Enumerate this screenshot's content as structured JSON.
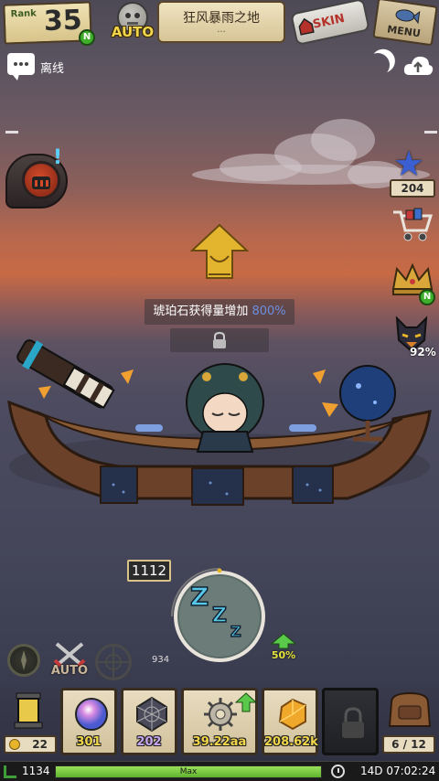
{
  "top": {
    "rank_label": "Rank",
    "rank_value": "35",
    "rank_badge": "N",
    "auto_label": "AUTO",
    "location_title": "狂风暴雨之地",
    "location_sub": "...",
    "skin_label": "SKIN",
    "menu_label": "MENU"
  },
  "status": {
    "offline_label": "离线"
  },
  "right": {
    "star_count": "204",
    "crown_badge": "N",
    "fox_percent": "92%"
  },
  "buff": {
    "text": "琥珀石获得量增加",
    "value": "800%"
  },
  "timer": {
    "value": "1112",
    "sub_value": "934",
    "boost": "50%",
    "boost_fraction": 0.5
  },
  "controls": {
    "auto_label": "AUTO"
  },
  "bottom": {
    "gold": "22",
    "slots": [
      {
        "value": "301",
        "color": "#f2d64a"
      },
      {
        "value": "202",
        "color": "#c9a6f0"
      },
      {
        "value": "39.22aa",
        "color": "#f2d64a"
      },
      {
        "value": "208.62k",
        "color": "#f2d64a"
      }
    ],
    "bag": "6 / 12"
  },
  "footer": {
    "level": "1134",
    "xp_label": "Max",
    "xp_fraction": 1.0,
    "time": "14D 07:02:24"
  },
  "colors": {
    "accent_green": "#3fae2a",
    "highlight_blue": "#6c8fe0"
  }
}
